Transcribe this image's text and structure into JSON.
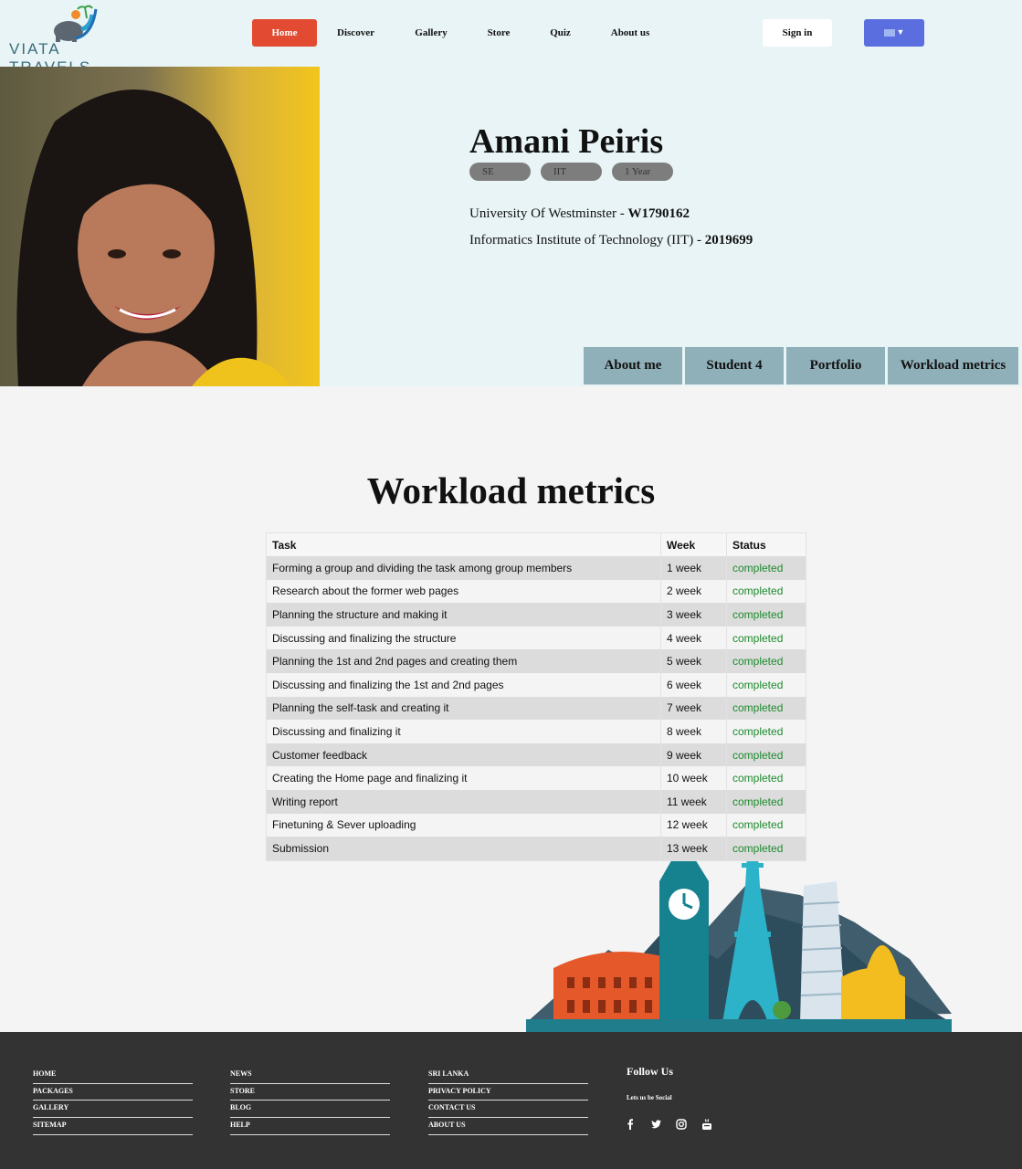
{
  "brand": {
    "logo_text": "VIATA TRAVELS"
  },
  "nav": {
    "items": [
      {
        "label": "Home",
        "active": true
      },
      {
        "label": "Discover"
      },
      {
        "label": "Gallery"
      },
      {
        "label": "Store"
      },
      {
        "label": "Quiz"
      },
      {
        "label": "About us"
      }
    ],
    "signin_label": "Sign in",
    "language_icon": "flag-dropdown-icon"
  },
  "profile": {
    "name": "Amani Peiris",
    "tags": [
      "SE",
      "IIT",
      "1 Year"
    ],
    "uni_text": "University Of Westminster - ",
    "uni_id": "W1790162",
    "iit_text": "Informatics Institute of Technology (IIT) - ",
    "iit_id": "2019699"
  },
  "tabs": [
    "About me",
    "Student 4",
    "Portfolio",
    "Workload metrics"
  ],
  "workload": {
    "title": "Workload metrics",
    "headers": [
      "Task",
      "Week",
      "Status"
    ],
    "rows": [
      [
        "Forming a group and dividing the task among group members",
        "1 week",
        "completed"
      ],
      [
        "Research about the former web pages",
        "2 week",
        "completed"
      ],
      [
        "Planning the structure and making it",
        "3 week",
        "completed"
      ],
      [
        "Discussing and finalizing the structure",
        "4 week",
        "completed"
      ],
      [
        "Planning the 1st and 2nd pages and creating them",
        "5 week",
        "completed"
      ],
      [
        "Discussing and finalizing the 1st and 2nd pages",
        "6 week",
        "completed"
      ],
      [
        "Planning the self-task and creating it",
        "7 week",
        "completed"
      ],
      [
        "Discussing and finalizing it",
        "8 week",
        "completed"
      ],
      [
        "Customer feedback",
        "9 week",
        "completed"
      ],
      [
        "Creating the Home page and finalizing it",
        "10 week",
        "completed"
      ],
      [
        "Writing report",
        "11 week",
        "completed"
      ],
      [
        "Finetuning & Sever uploading",
        "12 week",
        "completed"
      ],
      [
        "Submission",
        "13 week",
        "completed"
      ]
    ]
  },
  "footer": {
    "col1": [
      "HOME",
      "PACKAGES",
      "GALLERY",
      "SITEMAP"
    ],
    "col2": [
      "NEWS",
      "STORE",
      "BLOG",
      "HELP"
    ],
    "col3": [
      "SRI LANKA",
      "PRIVACY POLICY",
      "CONTACT US",
      "ABOUT US"
    ],
    "follow_title": "Follow Us",
    "follow_sub": "Lets us be Social",
    "social_icons": [
      "facebook-icon",
      "twitter-icon",
      "instagram-icon",
      "youtube-icon"
    ]
  },
  "colors": {
    "accent": "#e24b31",
    "hero_bg": "#e8f4f6",
    "tab_bg": "#8fafb9",
    "status_green": "#1e8a2e",
    "footer_bg": "#333333"
  }
}
